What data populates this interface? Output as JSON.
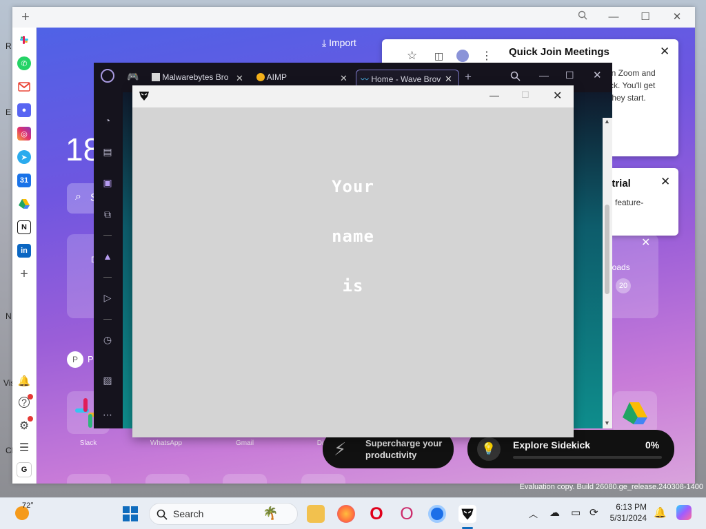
{
  "desktop": {
    "edge_letters": [
      "R",
      "E",
      "N",
      "Vis",
      "Ch"
    ],
    "watermark": "Evaluation copy. Build 26080.ge_release.240308-1400"
  },
  "sidekick": {
    "titlebar": {
      "add": "+"
    },
    "sidebar_apps": [
      {
        "name": "slack",
        "color": "#e01e5a"
      },
      {
        "name": "whatsapp",
        "color": "#25d366"
      },
      {
        "name": "gmail",
        "color": "#ea4335"
      },
      {
        "name": "discord",
        "color": "#5865f2"
      },
      {
        "name": "instagram",
        "color": "#e1306c"
      },
      {
        "name": "telegram",
        "color": "#2aabee"
      },
      {
        "name": "calendar",
        "color": "#1a73e8"
      },
      {
        "name": "drive",
        "color": "#1fa463"
      },
      {
        "name": "notion",
        "color": "#111111"
      },
      {
        "name": "linkedin",
        "color": "#0a66c2"
      }
    ],
    "sidebar_bottom": {
      "add": "+",
      "avatar": "G"
    },
    "import_label": "Import",
    "clock_partial": "18",
    "search_partial": "S",
    "tile_partial_text": "D",
    "downloads_label": "loads",
    "downloads_count": "20",
    "profile_letter": "P",
    "profile_partial": "P",
    "apps": [
      {
        "label": "Slack"
      },
      {
        "label": "WhatsApp"
      },
      {
        "label": "Gmail"
      },
      {
        "label": "Dis"
      }
    ],
    "popup_meetings": {
      "title": "Quick Join Meetings",
      "lines": [
        "in Zoom and",
        "ck. You'll get",
        "they start."
      ]
    },
    "popup_trial": {
      "title_partial": "o trial",
      "lines": [
        "feature-"
      ]
    },
    "pill_productivity": {
      "line1": "Supercharge your",
      "line2": "productivity"
    },
    "pill_explore": {
      "title": "Explore Sidekick",
      "percent": "0%",
      "progress": 0
    }
  },
  "opera": {
    "tabs": [
      {
        "label": "Malwarebytes Bro"
      },
      {
        "label": "AIMP"
      },
      {
        "label": "Home - Wave Brov"
      }
    ],
    "new_tab": "+"
  },
  "game": {
    "lines": [
      "Your",
      "name",
      "is"
    ]
  },
  "taskbar": {
    "weather_temp": "72°",
    "search_placeholder": "Search",
    "time": "6:13 PM",
    "date": "5/31/2024"
  }
}
